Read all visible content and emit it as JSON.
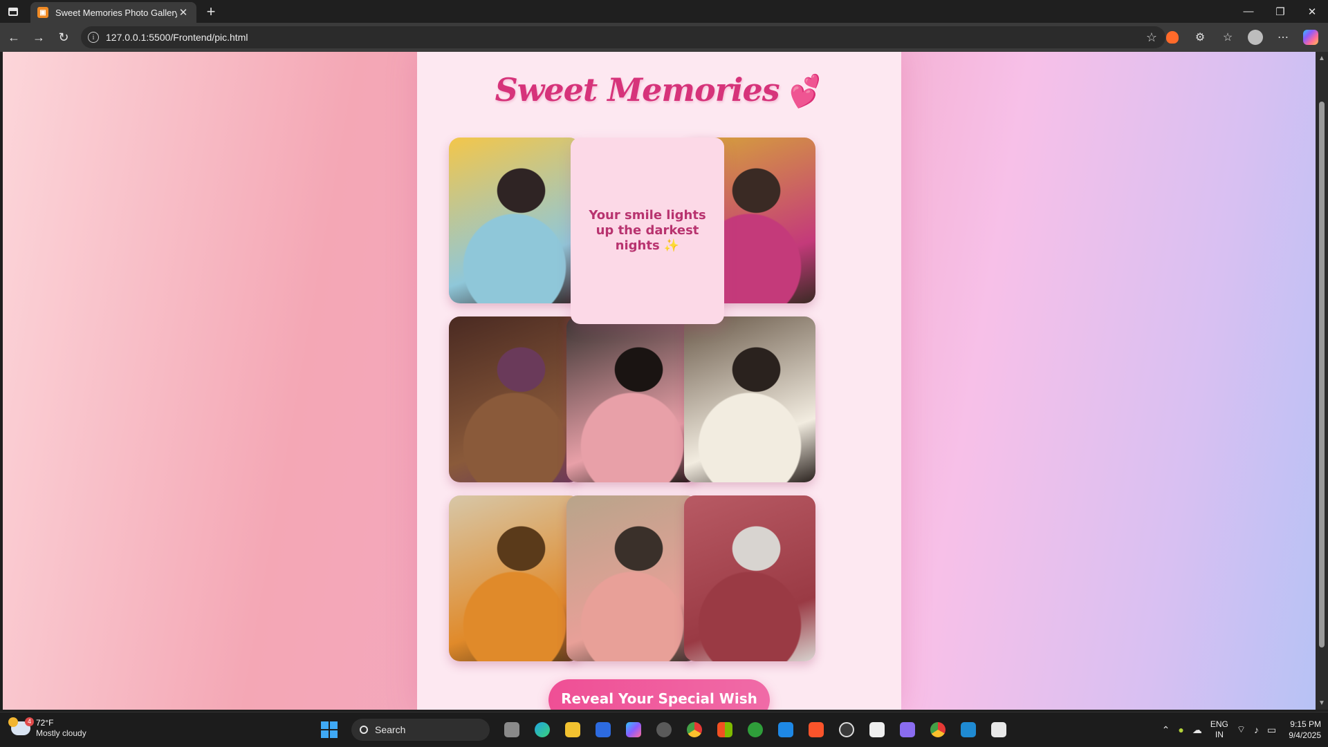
{
  "browser": {
    "tab_title": "Sweet Memories Photo Gallery",
    "tab_close": "✕",
    "new_tab": "+",
    "url": "127.0.0.1:5500/Frontend/pic.html",
    "window_controls": {
      "minimize": "—",
      "restore": "❐",
      "close": "✕"
    }
  },
  "page": {
    "title": "Sweet Memories",
    "title_emoji": "💕",
    "message": "Your smile lights up the darkest nights ✨",
    "reveal_button": "Reveal Your Special Wish",
    "photos": [
      {
        "name": "photo-1",
        "colors": [
          "#f3c64a",
          "#8fc7d9",
          "#2f2424"
        ]
      },
      {
        "name": "photo-2",
        "colors": [
          "#d6a43a",
          "#c43a7a",
          "#3a2a24"
        ]
      },
      {
        "name": "photo-3",
        "colors": [
          "#4a2a22",
          "#8a5a3a",
          "#6a3a5a"
        ]
      },
      {
        "name": "photo-4",
        "colors": [
          "#3a3432",
          "#e8a0a8",
          "#1a1412"
        ]
      },
      {
        "name": "photo-5",
        "colors": [
          "#6a5a4a",
          "#f2ece0",
          "#2a221e"
        ]
      },
      {
        "name": "photo-6",
        "colors": [
          "#d7c7a8",
          "#e08a2a",
          "#5a3a1a"
        ]
      },
      {
        "name": "photo-7",
        "colors": [
          "#b8a48a",
          "#e8a098",
          "#3a302a"
        ]
      },
      {
        "name": "photo-8",
        "colors": [
          "#b85a64",
          "#9a3a44",
          "#d8d4d0"
        ]
      }
    ]
  },
  "taskbar": {
    "weather_temp": "72°F",
    "weather_desc": "Mostly cloudy",
    "weather_badge": "4",
    "search": "Search",
    "lang_top": "ENG",
    "lang_bottom": "IN",
    "time": "9:15 PM",
    "date": "9/4/2025"
  },
  "colors": {
    "accent": "#d6337a",
    "button": "#ef4f95",
    "panel": "#fde8f1"
  }
}
